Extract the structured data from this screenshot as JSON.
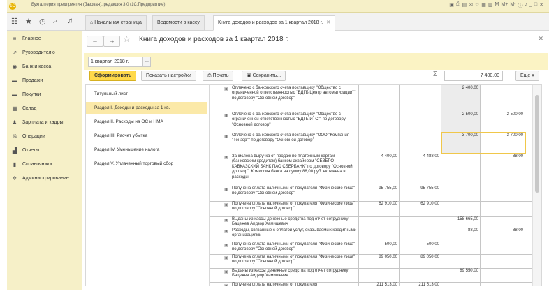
{
  "window": {
    "title": "Бухгалтерия предприятия (базовая), редакция 3.0  (1С:Предприятие)",
    "logo": "1С",
    "toolbar_icons": [
      "save-icon",
      "print-icon",
      "preview-icon",
      "email-icon",
      "fav-icon",
      "calc-icon",
      "cal-icon",
      "M",
      "M+",
      "M-",
      "info-icon",
      "bell-icon",
      "minimize-icon",
      "maximize-icon",
      "close-icon"
    ],
    "toolbar_glyphs": [
      "▣",
      "⎙",
      "▤",
      "✉",
      "☆",
      "▦",
      "▥",
      "M",
      "M+",
      "M-",
      "ⓘ",
      "♪",
      "_",
      "□",
      "✕"
    ]
  },
  "tabs": {
    "home": "Начальная страница",
    "t1": "Ведомости в кассу",
    "t2": "Книга доходов и расходов за 1 квартал 2018 г.",
    "close_glyph": "✕"
  },
  "topicons": {
    "apps": "☷",
    "star": "★",
    "history": "◷",
    "search": "⌕",
    "bell": "♫"
  },
  "sidebar": {
    "items": [
      {
        "label": "Главное",
        "icon": "≡"
      },
      {
        "label": "Руководителю",
        "icon": "↗"
      },
      {
        "label": "Банк и касса",
        "icon": "◉"
      },
      {
        "label": "Продажи",
        "icon": "▬"
      },
      {
        "label": "Покупки",
        "icon": "▬"
      },
      {
        "label": "Склад",
        "icon": "▦"
      },
      {
        "label": "Зарплата и кадры",
        "icon": "♟"
      },
      {
        "label": "Операции",
        "icon": "⅞"
      },
      {
        "label": "Отчеты",
        "icon": "▟"
      },
      {
        "label": "Справочники",
        "icon": "▮"
      },
      {
        "label": "Администрирование",
        "icon": "✲"
      }
    ]
  },
  "form": {
    "back": "←",
    "forward": "→",
    "star": "☆",
    "title": "Книга доходов и расходов за 1 квартал 2018 г.",
    "close": "✕",
    "period": "1 квартал 2018 г.",
    "period_btn": "...",
    "btn_generate": "Сформировать",
    "btn_settings": "Показать настройки",
    "btn_print": "Печать",
    "btn_save": "Сохранить...",
    "sum_icon": "Σ",
    "sum_value": "7 400,00",
    "btn_more": "Еще ▾"
  },
  "sections": [
    {
      "label": "Титульный лист",
      "active": false
    },
    {
      "label": "Раздел I. Доходы и расходы за 1 кв.",
      "active": true
    },
    {
      "label": "Раздел II. Расходы на ОС и НМА",
      "active": false
    },
    {
      "label": "Раздел III. Расчет убытка",
      "active": false
    },
    {
      "label": "Раздел IV. Уменьшение налога",
      "active": false
    },
    {
      "label": "Раздел V. Уплаченный торговый сбор",
      "active": false
    }
  ],
  "report_rows": [
    {
      "text": "Оплачено с банковского счета поставщику \"Общество с ограниченной ответственностью \"ВДГБ Центр автоматизации\"\" по договору \"Основной договор\"",
      "c1": "",
      "c2": "",
      "c3": "2 400,00",
      "c4": ""
    },
    {
      "text": "Оплачено с банковского счета поставщику \"Общество с ограниченной ответственностью \"ВДГБ ИТС\"\" по договору \"Основной договор\"",
      "c1": "",
      "c2": "",
      "c3": "2 500,00",
      "c4": "2 500,00"
    },
    {
      "text": "Оплачено с банковского счета поставщику \"ООО \"Компания \"Тензор\"\" по договору \"Основной договор\"",
      "c1": "",
      "c2": "",
      "c3": "3 700,00",
      "c4": "3 700,00"
    },
    {
      "text": "Зачислена выручка от продаж по платежным картам (банковским кредитам) банком-эквайером \"СЕВЕРО-КАВКАЗСКИЙ БАНК ПАО СБЕРБАНК\" по договору \"Основной договор\". Комиссия банка на сумму 88,00 руб. включена в расходы",
      "c1": "4 400,00",
      "c2": "4 488,00",
      "c3": "",
      "c4": "88,00"
    },
    {
      "text": "Получена оплата наличными от покупателя \"Физические лица\" по договору \"Основной договор\"",
      "c1": "95 755,00",
      "c2": "95 755,00",
      "c3": "",
      "c4": ""
    },
    {
      "text": "Получена оплата наличными от покупателя \"Физические лица\" по договору \"Основной договор\"",
      "c1": "62 910,00",
      "c2": "62 910,00",
      "c3": "",
      "c4": ""
    },
    {
      "text": "Выданы из кассы денежные средства под отчет сотруднику Бацежев Аидзор Хамишевич",
      "c1": "",
      "c2": "",
      "c3": "158 665,00",
      "c4": ""
    },
    {
      "text": "Расходы, связанные с оплатой услуг, оказываемых кредитными организациями",
      "c1": "",
      "c2": "",
      "c3": "88,00",
      "c4": "88,00"
    },
    {
      "text": "Получена оплата наличными от покупателя \"Физические лица\" по договору \"Основной договор\"",
      "c1": "500,00",
      "c2": "500,00",
      "c3": "",
      "c4": ""
    },
    {
      "text": "Получена оплата наличными от покупателя \"Физические лица\" по договору \"Основной договор\"",
      "c1": "89 050,00",
      "c2": "89 050,00",
      "c3": "",
      "c4": ""
    },
    {
      "text": "Выданы из кассы денежные средства под отчет сотруднику Бацежев Аидзор Хамишевич",
      "c1": "",
      "c2": "",
      "c3": "89 550,00",
      "c4": ""
    },
    {
      "text": "Получена оплата наличными от покупателя",
      "c1": "211 513,00",
      "c2": "211 513,00",
      "c3": "",
      "c4": ""
    }
  ],
  "row_icon": "▣"
}
